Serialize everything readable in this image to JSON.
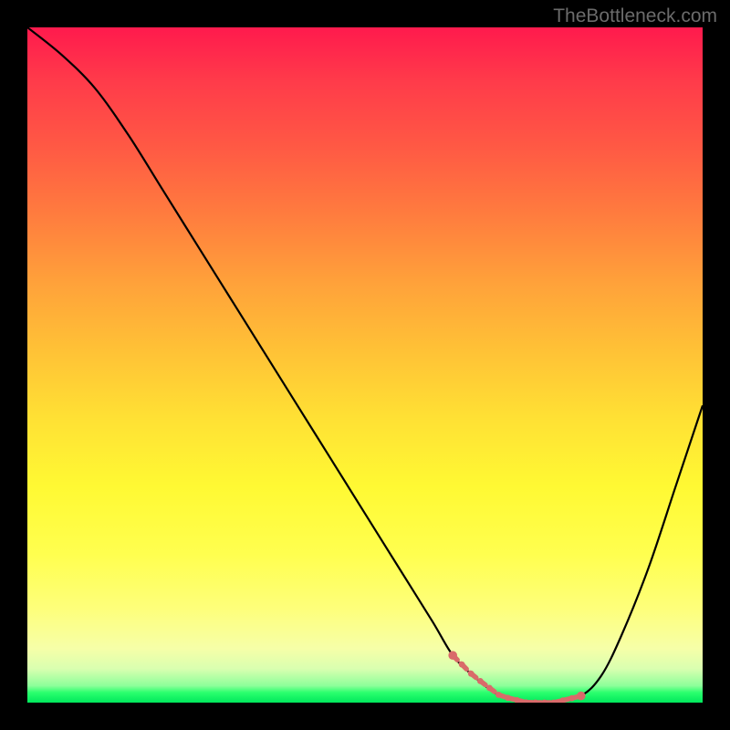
{
  "watermark": "TheBottleneck.com",
  "colors": {
    "background": "#000000",
    "curve": "#000000",
    "marker": "#d96a6a",
    "gradient_top": "#ff1a4d",
    "gradient_bottom": "#00e85c"
  },
  "chart_data": {
    "type": "line",
    "title": "",
    "xlabel": "",
    "ylabel": "",
    "xlim": [
      0,
      100
    ],
    "ylim": [
      0,
      100
    ],
    "x": [
      0,
      5,
      10,
      15,
      20,
      25,
      30,
      35,
      40,
      45,
      50,
      55,
      60,
      63,
      66,
      70,
      74,
      78,
      82,
      85,
      88,
      92,
      96,
      100
    ],
    "y": [
      100,
      96,
      91,
      84,
      76,
      68,
      60,
      52,
      44,
      36,
      28,
      20,
      12,
      7,
      4,
      1,
      0,
      0,
      1,
      4,
      10,
      20,
      32,
      44
    ],
    "optimal_range_x": [
      63,
      82
    ],
    "annotations": []
  }
}
